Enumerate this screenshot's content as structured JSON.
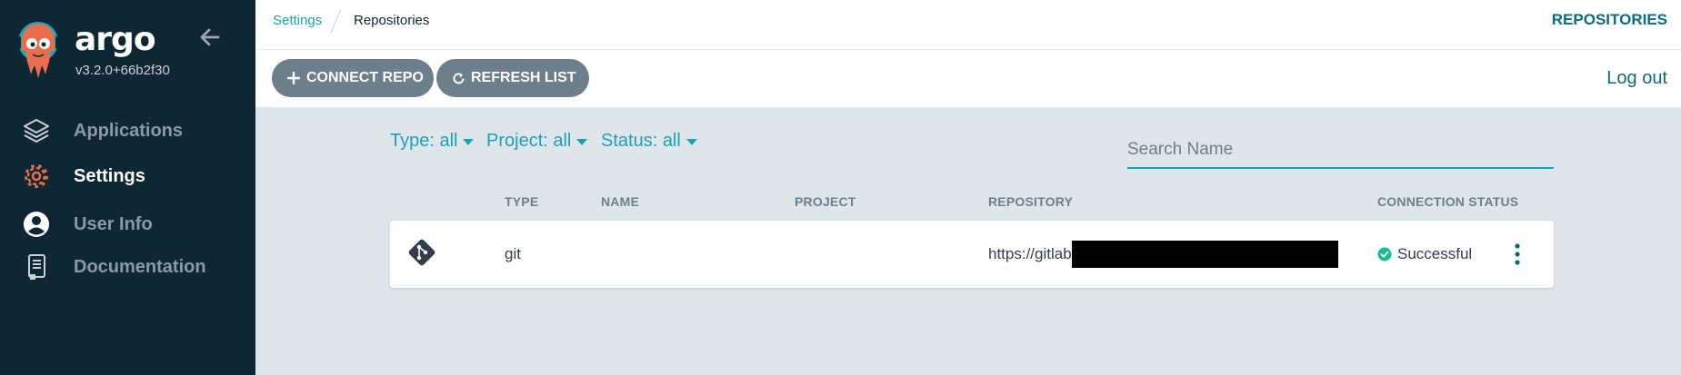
{
  "app": {
    "brand_name": "argo",
    "version": "v3.2.0+66b2f30"
  },
  "sidebar": {
    "items": [
      {
        "label": "Applications",
        "icon": "layers-icon",
        "active": false
      },
      {
        "label": "Settings",
        "icon": "gear-icon",
        "active": true
      },
      {
        "label": "User Info",
        "icon": "user-icon",
        "active": false
      },
      {
        "label": "Documentation",
        "icon": "book-icon",
        "active": false
      }
    ]
  },
  "breadcrumb": {
    "parent": "Settings",
    "current": "Repositories"
  },
  "header": {
    "title": "REPOSITORIES"
  },
  "toolbar": {
    "connect_label": "CONNECT REPO",
    "refresh_label": "REFRESH LIST",
    "logout_label": "Log out"
  },
  "filters": {
    "type": "Type: all",
    "project": "Project: all",
    "status": "Status: all"
  },
  "search": {
    "placeholder": "Search Name",
    "value": ""
  },
  "table": {
    "columns": [
      "TYPE",
      "NAME",
      "PROJECT",
      "REPOSITORY",
      "CONNECTION STATUS"
    ],
    "rows": [
      {
        "type": "git",
        "name": "",
        "project": "",
        "repository": "https://gitlab",
        "status": "Successful"
      }
    ]
  },
  "colors": {
    "sidebar_bg": "#0f2733",
    "accent": "#1aa4b2",
    "heading": "#0f6a7e",
    "button_bg": "#6d7f8b",
    "success": "#18be94",
    "active_icon": "#e96d4f"
  }
}
